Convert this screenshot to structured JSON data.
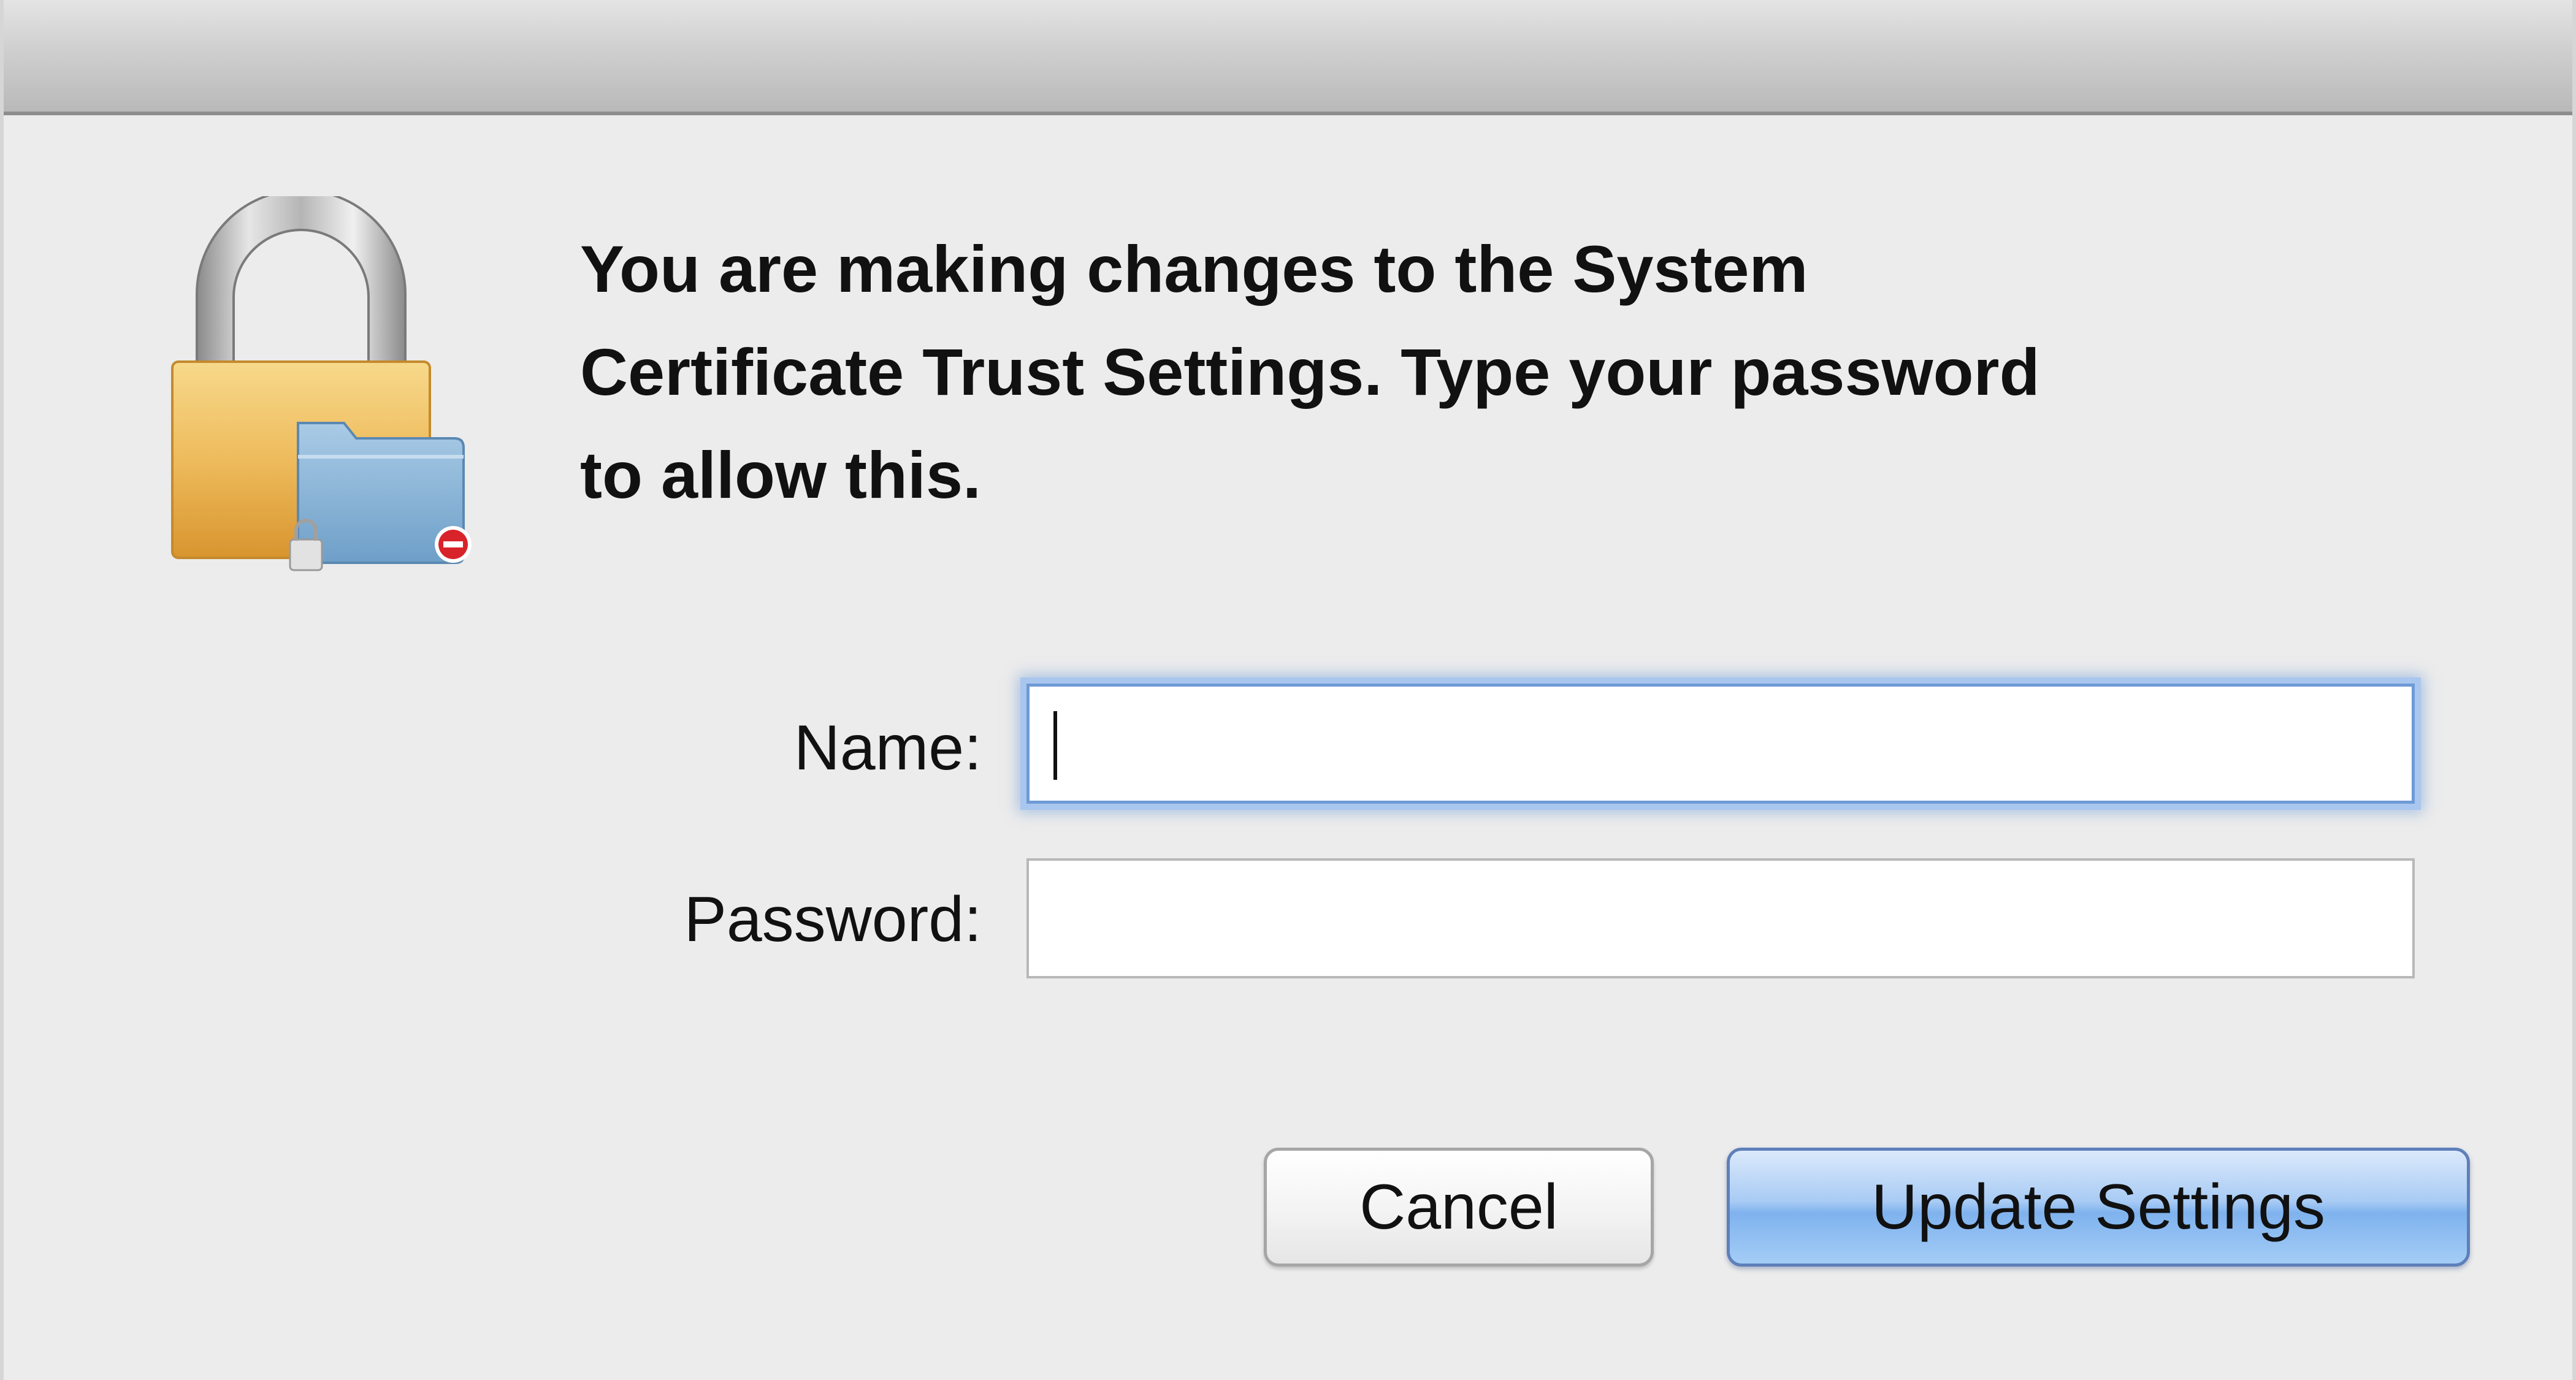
{
  "dialog": {
    "message": "You are making changes to the System\nCertificate Trust Settings. Type your password\nto allow this.",
    "name_label": "Name:",
    "name_value": "",
    "password_label": "Password:",
    "password_value": "",
    "cancel_label": "Cancel",
    "update_label": "Update Settings",
    "icon": "lock-folder-icon",
    "colors": {
      "background": "#ececec",
      "focus_ring": "#6f9bd6",
      "default_button": "#7fb2ee",
      "lock_body": "#e9b255"
    }
  }
}
